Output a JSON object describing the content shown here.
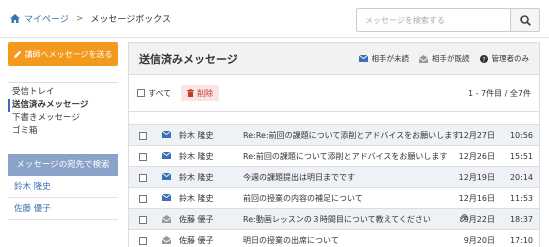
{
  "breadcrumb": {
    "home": "マイページ",
    "current": "メッセージボックス"
  },
  "search": {
    "placeholder": "メッセージを検索する"
  },
  "sidebar": {
    "send_button": "講師へメッセージを送る",
    "nav": [
      {
        "label": "受信トレイ",
        "active": false
      },
      {
        "label": "送信済みメッセージ",
        "active": true
      },
      {
        "label": "下書きメッセージ",
        "active": false
      },
      {
        "label": "ゴミ箱",
        "active": false
      }
    ],
    "search_head": "メッセージの宛先で検索",
    "people": [
      "鈴木 隆史",
      "佐藤 優子"
    ]
  },
  "main": {
    "title": "送信済みメッセージ",
    "legend": {
      "unread": "相手が未読",
      "read": "相手が既読",
      "admin_only": "管理者のみ"
    },
    "select_all": "すべて",
    "delete": "削除",
    "count": "1 - 7件目 / 全7件",
    "rows": [
      {
        "status": "unread",
        "from": "鈴木 隆史",
        "subject": "Re:Re:前回の課題について添削とアドバイスをお願いします",
        "attachment": false,
        "date": "12月27日",
        "time": "10:56"
      },
      {
        "status": "unread",
        "from": "鈴木 隆史",
        "subject": "Re:前回の課題について添削とアドバイスをお願いします",
        "attachment": false,
        "date": "12月26日",
        "time": "15:51"
      },
      {
        "status": "unread",
        "from": "鈴木 隆史",
        "subject": "今週の課題提出は明日までです",
        "attachment": false,
        "date": "12月19日",
        "time": "20:14"
      },
      {
        "status": "unread",
        "from": "鈴木 隆史",
        "subject": "前回の授業の内容の補足について",
        "attachment": false,
        "date": "12月16日",
        "time": "11:53"
      },
      {
        "status": "read",
        "from": "佐藤 優子",
        "subject": "Re:動画レッスンの３時間目について教えてください",
        "attachment": true,
        "date": "9月22日",
        "time": "18:37"
      },
      {
        "status": "read",
        "from": "佐藤 優子",
        "subject": "明日の授業の出席について",
        "attachment": false,
        "date": "9月20日",
        "time": "17:10"
      }
    ]
  },
  "colors": {
    "accent": "#f39a1e",
    "link": "#3b6fb6",
    "unread_icon": "#3b6fb6",
    "read_icon": "#999999"
  }
}
